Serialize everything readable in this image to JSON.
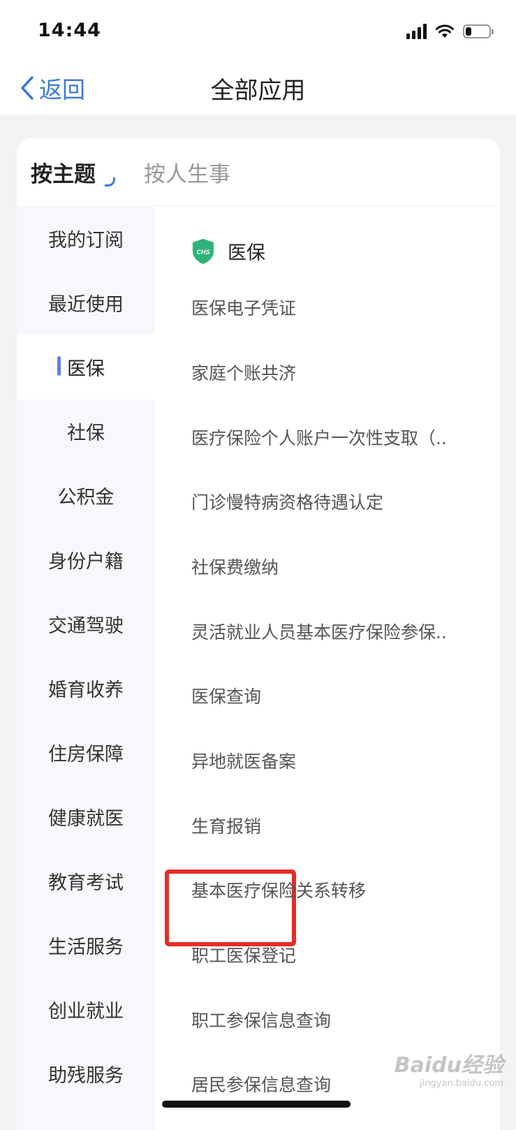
{
  "status_bar": {
    "time": "14:44"
  },
  "nav": {
    "back_label": "返回",
    "title": "全部应用"
  },
  "tabs": {
    "active": "按主题",
    "inactive": "按人生事"
  },
  "sidebar": {
    "items": [
      {
        "label": "我的订阅"
      },
      {
        "label": "最近使用"
      },
      {
        "label": "医保"
      },
      {
        "label": "社保"
      },
      {
        "label": "公积金"
      },
      {
        "label": "身份户籍"
      },
      {
        "label": "交通驾驶"
      },
      {
        "label": "婚育收养"
      },
      {
        "label": "住房保障"
      },
      {
        "label": "健康就医"
      },
      {
        "label": "教育考试"
      },
      {
        "label": "生活服务"
      },
      {
        "label": "创业就业"
      },
      {
        "label": "助残服务"
      }
    ],
    "active_index": 2
  },
  "section": {
    "icon": "chs-shield-icon",
    "icon_text": "CHS",
    "title": "医保",
    "services": [
      {
        "label": "医保电子凭证"
      },
      {
        "label": "家庭个账共济"
      },
      {
        "label": "医疗保险个人账户一次性支取（.."
      },
      {
        "label": "门诊慢特病资格待遇认定"
      },
      {
        "label": "社保费缴纳"
      },
      {
        "label": "灵活就业人员基本医疗保险参保.."
      },
      {
        "label": "医保查询"
      },
      {
        "label": "异地就医备案"
      },
      {
        "label": "生育报销"
      },
      {
        "label": "基本医疗保险关系转移"
      },
      {
        "label": "职工医保登记"
      },
      {
        "label": "职工参保信息查询"
      },
      {
        "label": "居民参保信息查询"
      }
    ],
    "highlighted_index": 8
  },
  "watermark": {
    "main": "Baidu经验",
    "sub": "jingyan.baidu.com"
  },
  "colors": {
    "accent": "#3a7bd5",
    "highlight": "#e52d27",
    "shield": "#2fb37a"
  }
}
